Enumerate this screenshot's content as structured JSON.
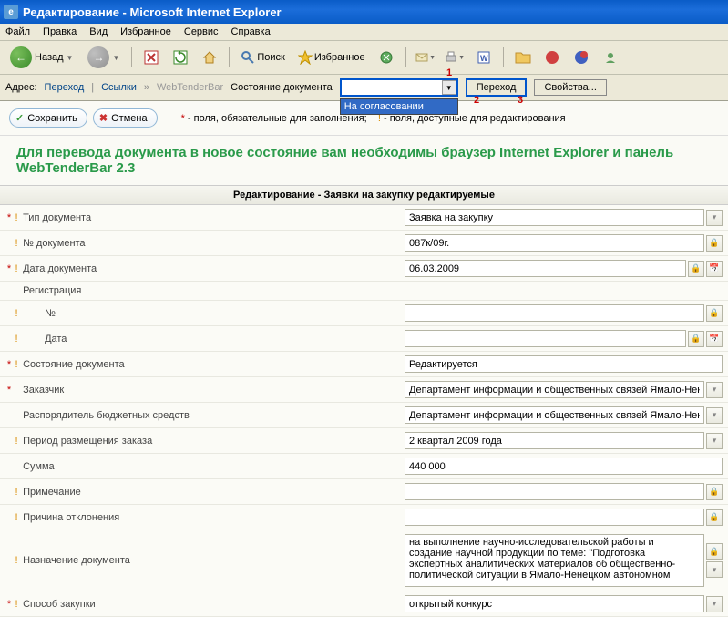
{
  "window": {
    "title": "Редактирование - Microsoft Internet Explorer"
  },
  "menu": {
    "file": "Файл",
    "edit": "Правка",
    "view": "Вид",
    "favorites": "Избранное",
    "service": "Сервис",
    "help": "Справка"
  },
  "toolbar": {
    "back": "Назад",
    "search": "Поиск",
    "favorites": "Избранное"
  },
  "addressbar": {
    "label": "Адрес:",
    "perehod": "Переход",
    "links": "Ссылки",
    "wtb": "WebTenderBar",
    "state_label": "Состояние документа",
    "dropdown_item": "На согласовании",
    "go_btn": "Переход",
    "props_btn": "Свойства...",
    "annot1": "1",
    "annot2": "2",
    "annot3": "3"
  },
  "actions": {
    "save": "Сохранить",
    "cancel": "Отмена",
    "legend_req_mark": "*",
    "legend_req": " - поля, обязательные для заполнения;",
    "legend_edt_mark": "!",
    "legend_edt": " - поля, доступные для редактирования"
  },
  "banner": "Для перевода документа в новое состояние вам необходимы браузер Internet Explorer и панель WebTenderBar 2.3",
  "form": {
    "title": "Редактирование - Заявки на закупку редактируемые",
    "rows": [
      {
        "req": true,
        "edt": true,
        "label": "Тип документа",
        "value": "Заявка на закупку",
        "ctl": "select"
      },
      {
        "req": false,
        "edt": true,
        "label": "№ документа",
        "value": "087к/09г.",
        "ctl": "lock"
      },
      {
        "req": true,
        "edt": true,
        "label": "Дата документа",
        "value": "06.03.2009",
        "ctl": "date"
      },
      {
        "req": false,
        "edt": false,
        "label": "Регистрация",
        "value": "",
        "ctl": "header"
      },
      {
        "req": false,
        "edt": true,
        "label": "№",
        "value": "",
        "ctl": "lock",
        "indent": true
      },
      {
        "req": false,
        "edt": true,
        "label": "Дата",
        "value": "",
        "ctl": "date",
        "indent": true
      },
      {
        "req": true,
        "edt": true,
        "label": "Состояние документа",
        "value": "Редактируется",
        "ctl": "none"
      },
      {
        "req": true,
        "edt": false,
        "label": "Заказчик",
        "value": "Департамент информации и общественных связей Ямало-Ненецкого авт",
        "ctl": "select"
      },
      {
        "req": false,
        "edt": false,
        "label": "Распорядитель бюджетных средств",
        "value": "Департамент информации и общественных связей Ямало-Ненецкого авт",
        "ctl": "select"
      },
      {
        "req": false,
        "edt": true,
        "label": "Период размещения заказа",
        "value": "2 квартал 2009 года",
        "ctl": "select"
      },
      {
        "req": false,
        "edt": false,
        "label": "Сумма",
        "value": "440 000",
        "ctl": "plain"
      },
      {
        "req": false,
        "edt": true,
        "label": "Примечание",
        "value": "",
        "ctl": "lock"
      },
      {
        "req": false,
        "edt": true,
        "label": "Причина отклонения",
        "value": "",
        "ctl": "lock"
      },
      {
        "req": false,
        "edt": true,
        "label": "Назначение документа",
        "value": "на выполнение научно-исследовательской работы и создание научной продукции по теме: \"Подготовка экспертных аналитических материалов об общественно-политической ситуации в Ямало-Ненецком автономном",
        "ctl": "textarea"
      },
      {
        "req": true,
        "edt": true,
        "label": "Способ закупки",
        "value": "открытый конкурс",
        "ctl": "select"
      }
    ]
  }
}
